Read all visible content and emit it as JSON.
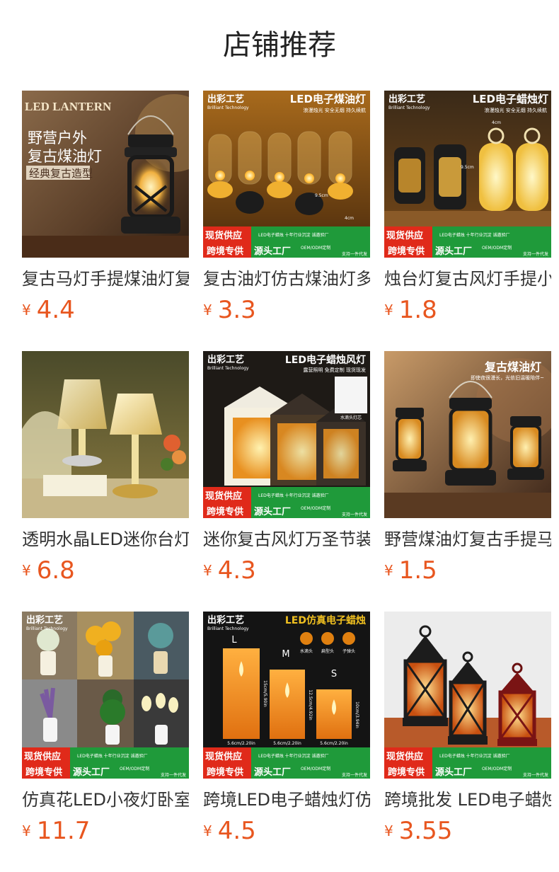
{
  "page": {
    "title": "店铺推荐"
  },
  "colors": {
    "price": "#e8561f",
    "banner_red": "#e02a1a",
    "banner_green": "#1f9a3a"
  },
  "products": [
    {
      "name": "复古马灯手提煤油灯复古",
      "currency": "¥",
      "price": "4.4",
      "image": {
        "icon": "lantern-icon",
        "texts": [
          "LED LANTERN",
          "野营户外",
          "复古煤油灯",
          "经典复古造型"
        ]
      }
    },
    {
      "name": "复古油灯仿古煤油灯多款",
      "currency": "¥",
      "price": "3.3",
      "image": {
        "icon": "oil-lamp-icon",
        "texts": [
          "出彩工艺",
          "Brilliant Technology",
          "LED电子煤油灯",
          "浪漫烛光 安全无烟 持久续航",
          "9.5cm",
          "4cm",
          "现货供应",
          "跨境专供",
          "源头工厂",
          "LED电子蜡烛 十年行业沉淀 诚邀验厂",
          "OEM/ODM定制",
          "支持一件代发"
        ]
      }
    },
    {
      "name": "烛台灯复古风灯手提小马灯",
      "currency": "¥",
      "price": "1.8",
      "image": {
        "icon": "candle-lantern-icon",
        "texts": [
          "出彩工艺",
          "Brilliant Technology",
          "LED电子蜡烛灯",
          "浪漫烛光 安全无烟 持久续航",
          "4cm",
          "9.5cm",
          "现货供应",
          "跨境专供",
          "源头工厂",
          "LED电子蜡烛 十年行业沉淀 诚邀验厂",
          "OEM/ODM定制",
          "支持一件代发"
        ]
      }
    },
    {
      "name": "透明水晶LED迷你台灯",
      "currency": "¥",
      "price": "6.8",
      "image": {
        "icon": "crystal-lamp-icon",
        "texts": []
      }
    },
    {
      "name": "迷你复古风灯万圣节装饰",
      "currency": "¥",
      "price": "4.3",
      "image": {
        "icon": "wind-lantern-icon",
        "texts": [
          "出彩工艺",
          "Brilliant Technology",
          "LED电子蜡烛风灯",
          "露营照明 免费定制 现货现发",
          "水滴头灯芯",
          "现货供应",
          "跨境专供",
          "源头工厂",
          "LED电子蜡烛 十年行业沉淀 诚邀验厂",
          "OEM/ODM定制",
          "支持一件代发"
        ]
      }
    },
    {
      "name": "野营煤油灯复古手提马灯",
      "currency": "¥",
      "price": "1.5",
      "image": {
        "icon": "camping-lantern-icon",
        "texts": [
          "复古煤油灯",
          "即使夜很漫长，光依旧温暖陪伴~"
        ]
      }
    },
    {
      "name": "仿真花LED小夜灯卧室装饰",
      "currency": "¥",
      "price": "11.7",
      "image": {
        "icon": "flower-night-light-icon",
        "texts": [
          "出彩工艺",
          "Brilliant Technology",
          "现货供应",
          "跨境专供",
          "源头工厂",
          "LED电子蜡烛 十年行业沉淀 诚邀验厂",
          "OEM/ODM定制",
          "支持一件代发"
        ]
      }
    },
    {
      "name": "跨境LED电子蜡烛灯仿真",
      "currency": "¥",
      "price": "4.5",
      "image": {
        "icon": "led-candle-icon",
        "texts": [
          "出彩工艺",
          "Brilliant Technology",
          "LED仿真电子蜡烛",
          "L",
          "M",
          "S",
          "水滴头",
          "扁型头",
          "子弹头",
          "15cm/5.90in",
          "12.5cm/4.92in",
          "10cm/3.94in",
          "5.6cm/2.20in",
          "5.6cm/2.20in",
          "5.6cm/2.20in",
          "现货供应",
          "跨境专供",
          "源头工厂",
          "LED电子蜡烛 十年行业沉淀 诚邀验厂",
          "OEM/ODM定制",
          "支持一件代发"
        ]
      }
    },
    {
      "name": "跨境批发 LED电子蜡烛灯",
      "currency": "¥",
      "price": "3.55",
      "image": {
        "icon": "moroccan-lantern-icon",
        "texts": [
          "现货供应",
          "跨境专供",
          "源头工厂",
          "LED电子蜡烛 十年行业沉淀 诚邀验厂",
          "OEM/ODM定制",
          "支持一件代发"
        ]
      }
    }
  ]
}
